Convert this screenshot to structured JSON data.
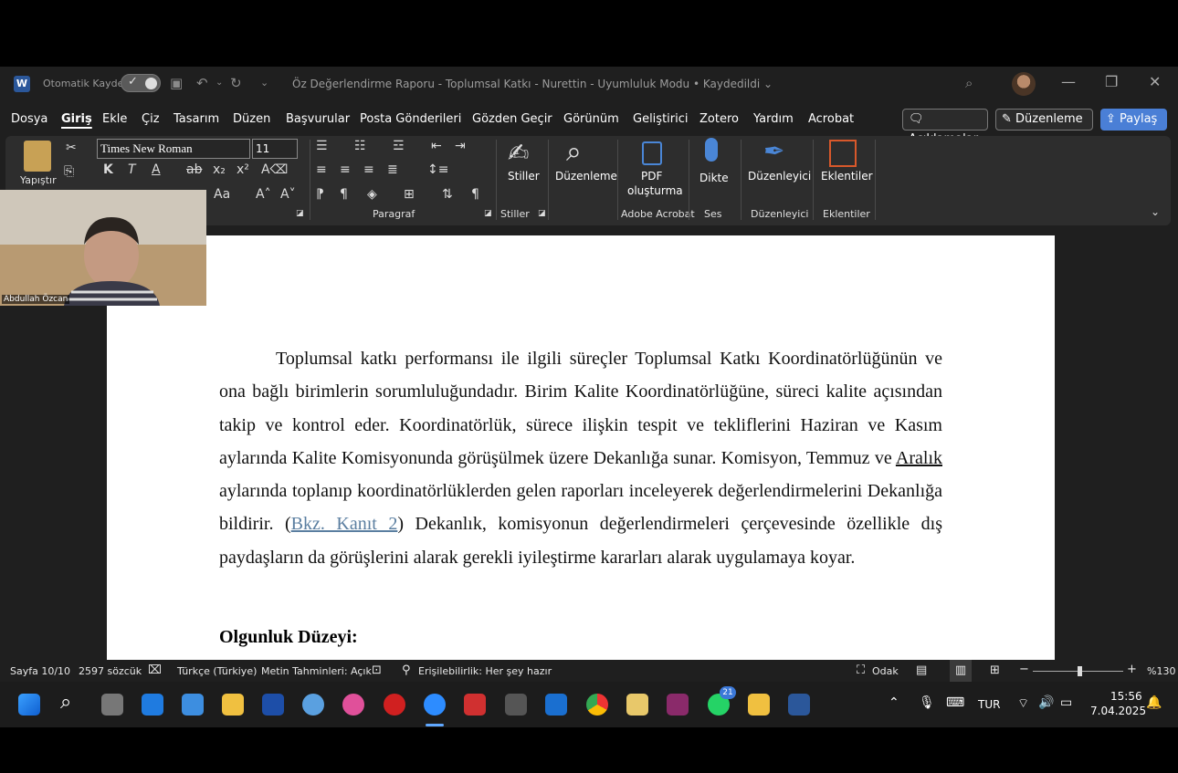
{
  "titlebar": {
    "autosave_label": "Otomatik Kaydet",
    "document_title": "Öz Değerlendirme Raporu - Toplumsal Katkı - Nurettin  -  Uyumluluk Modu • Kaydedildi ⌄"
  },
  "menu": {
    "items": [
      "Dosya",
      "Giriş",
      "Ekle",
      "Çiz",
      "Tasarım",
      "Düzen",
      "Başvurular",
      "Posta Gönderileri",
      "Gözden Geçir",
      "Görünüm",
      "Geliştirici",
      "Zotero",
      "Yardım",
      "Acrobat"
    ],
    "active": "Giriş",
    "comments_label": "Açıklamalar",
    "editing_label": "Düzenleme",
    "share_label": "Paylaş"
  },
  "ribbon": {
    "paste_label": "Yapıştır",
    "font_name": "Times New Roman",
    "font_size": "11",
    "bold": "K",
    "italic": "T",
    "paragraph_group": "Paragraf",
    "styles_label": "Stiller",
    "styles_group": "Stiller",
    "find_label": "Düzenleme",
    "pdf_label_1": "PDF",
    "pdf_label_2": "oluşturma",
    "acrobat_group": "Adobe Acrobat",
    "dictate_label": "Dikte",
    "voice_group": "Ses",
    "editor_label": "Düzenleyici",
    "editor_group": "Düzenleyici",
    "addins_label": "Eklentiler",
    "addins_group": "Eklentiler"
  },
  "webcam": {
    "participant_name": "Abdullah Özcan"
  },
  "document": {
    "para_part1": "Toplumsal katkı performansı ile ilgili süreçler Toplumsal Katkı Koordinatörlüğünün ve ona bağlı birimlerin sorumluluğundadır. Birim Kalite Koordinatörlüğüne, süreci kalite açısından takip ve kontrol eder. Koordinatörlük, sürece ilişkin tespit ve tekliflerini Haziran ve Kasım aylarında Kalite Komisyonunda görüşülmek üzere Dekanlığa sunar. Komisyon, Temmuz ve ",
    "para_underlined": "Aralık",
    "para_part2": " aylarında toplanıp koordinatörlüklerden gelen raporları inceleyerek değerlendirmelerini Dekanlığa bildirir. (",
    "para_link": "Bkz. Kanıt 2",
    "para_part3": ") Dekanlık, komisyonun değerlendirmeleri çerçevesinde özellikle dış paydaşların da görüşlerini alarak gerekli iyileştirme kararları alarak uygulamaya koyar.",
    "heading": "Olgunluk Düzeyi:"
  },
  "status": {
    "page": "Sayfa 10/10",
    "words": "2597 sözcük",
    "language": "Türkçe (Türkiye)",
    "predictions": "Metin Tahminleri: Açık",
    "accessibility": "Erişilebilirlik: Her şey hazır",
    "focus": "Odak",
    "zoom": "%130"
  },
  "taskbar": {
    "whatsapp_badge": "21",
    "language": "TUR",
    "time": "15:56",
    "date": "7.04.2025"
  }
}
